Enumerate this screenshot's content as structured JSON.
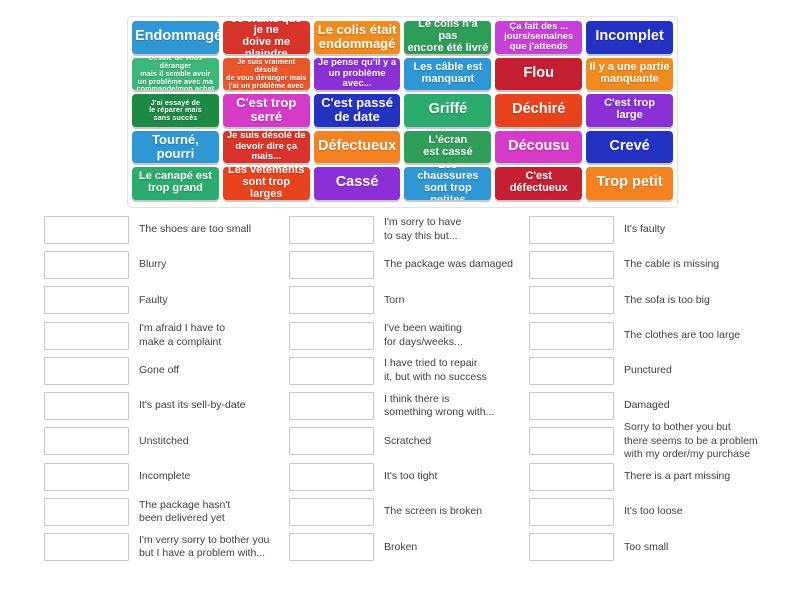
{
  "tile_grid": {
    "rows": [
      [
        {
          "text": "Endommagé",
          "color": "#2e97d4",
          "size": "fs-xl"
        },
        {
          "text": "Je crains que je ne\ndoive me plaindre",
          "color": "#d9342b",
          "size": "fs-md"
        },
        {
          "text": "Le colis était\nendommagé",
          "color": "#f08c1e",
          "size": "fs-lg"
        },
        {
          "text": "Le colis n'a pas\nencore été livré",
          "color": "#2e9e58",
          "size": "fs-md"
        },
        {
          "text": "Ça fait des ...\njours/semaines\nque j'attends",
          "color": "#c840d8",
          "size": "fs-sm"
        },
        {
          "text": "Incomplet",
          "color": "#2432c4",
          "size": "fs-xl"
        }
      ],
      [
        {
          "text": "Désolé de vous déranger\nmais il semble avoir\nun problème avec ma\ncommande/mon achat",
          "color": "#3cb878",
          "size": "fs-xs"
        },
        {
          "text": "Je suis vraiment désolé\nde vous déranger mais\nj'ai un problème avec",
          "color": "#e8562a",
          "size": "fs-xs"
        },
        {
          "text": "Je pense qu'il y a\nun problème avec...",
          "color": "#8b2fd6",
          "size": "fs-sm"
        },
        {
          "text": "Les câble est\nmanquant",
          "color": "#2e97d4",
          "size": "fs-md"
        },
        {
          "text": "Flou",
          "color": "#c42032",
          "size": "fs-xl"
        },
        {
          "text": "Il y a une partie\nmanquante",
          "color": "#f08c1e",
          "size": "fs-md"
        }
      ],
      [
        {
          "text": "J'ai essayé de\nle réparer mais\nsans succès",
          "color": "#1d8a44",
          "size": "fs-xs"
        },
        {
          "text": "C'est trop\nserré",
          "color": "#d63ac8",
          "size": "fs-lg"
        },
        {
          "text": "C'est passé\nde date",
          "color": "#2432c4",
          "size": "fs-lg"
        },
        {
          "text": "Griffé",
          "color": "#2bab6e",
          "size": "fs-xl"
        },
        {
          "text": "Déchiré",
          "color": "#e8431c",
          "size": "fs-xl"
        },
        {
          "text": "C'est trop\nlarge",
          "color": "#8b2fd6",
          "size": "fs-md"
        }
      ],
      [
        {
          "text": "Tourné,\npourri",
          "color": "#2e97d4",
          "size": "fs-lg"
        },
        {
          "text": "Je suis désolé de\ndevoir dire ça mais...",
          "color": "#d9342b",
          "size": "fs-sm"
        },
        {
          "text": "Défectueux",
          "color": "#f58220",
          "size": "fs-xl"
        },
        {
          "text": "L'écran\nest cassé",
          "color": "#2e9e58",
          "size": "fs-md"
        },
        {
          "text": "Décousu",
          "color": "#d63ac8",
          "size": "fs-xl"
        },
        {
          "text": "Crevé",
          "color": "#2432c4",
          "size": "fs-xl"
        }
      ],
      [
        {
          "text": "Le canapé est\ntrop grand",
          "color": "#2bab6e",
          "size": "fs-md"
        },
        {
          "text": "Les vêtements\nsont trop larges",
          "color": "#e8431c",
          "size": "fs-md"
        },
        {
          "text": "Cassé",
          "color": "#8b2fd6",
          "size": "fs-xl"
        },
        {
          "text": "Les chaussures\nsont trop petites",
          "color": "#2e97d4",
          "size": "fs-md"
        },
        {
          "text": "C'est\ndéfectueux",
          "color": "#c42032",
          "size": "fs-md"
        },
        {
          "text": "Trop petit",
          "color": "#f58220",
          "size": "fs-xl"
        }
      ]
    ]
  },
  "answers": {
    "columns": [
      [
        {
          "label": "The shoes are too small"
        },
        {
          "label": "Blurry"
        },
        {
          "label": "Faulty"
        },
        {
          "label": "I'm afraid I have to\nmake a complaint"
        },
        {
          "label": "Gone off"
        },
        {
          "label": "It's past its sell-by-date"
        },
        {
          "label": "Unstitched"
        },
        {
          "label": "Incomplete"
        },
        {
          "label": "The package hasn't\nbeen delivered yet"
        },
        {
          "label": "I'm verry sorry to bother you\nbut I have a problem with..."
        }
      ],
      [
        {
          "label": "I'm sorry to have\nto say this but..."
        },
        {
          "label": "The package was damaged"
        },
        {
          "label": "Torn"
        },
        {
          "label": "I've been waiting\nfor days/weeks..."
        },
        {
          "label": "I have tried to repair\nit, but with no success"
        },
        {
          "label": "I think there is\nsomething wrong with..."
        },
        {
          "label": "Scratched"
        },
        {
          "label": "It's too tight"
        },
        {
          "label": "The screen is broken"
        },
        {
          "label": "Broken"
        }
      ],
      [
        {
          "label": "It's faulty"
        },
        {
          "label": "The cable is missing"
        },
        {
          "label": "The sofa is too big"
        },
        {
          "label": "The clothes are too large"
        },
        {
          "label": "Punctured"
        },
        {
          "label": "Damaged"
        },
        {
          "label": "Sorry to bother you but\nthere seems to be a problem\nwith my order/my purchase"
        },
        {
          "label": "There is a part missing"
        },
        {
          "label": "It's too loose"
        },
        {
          "label": "Too small"
        }
      ]
    ]
  }
}
